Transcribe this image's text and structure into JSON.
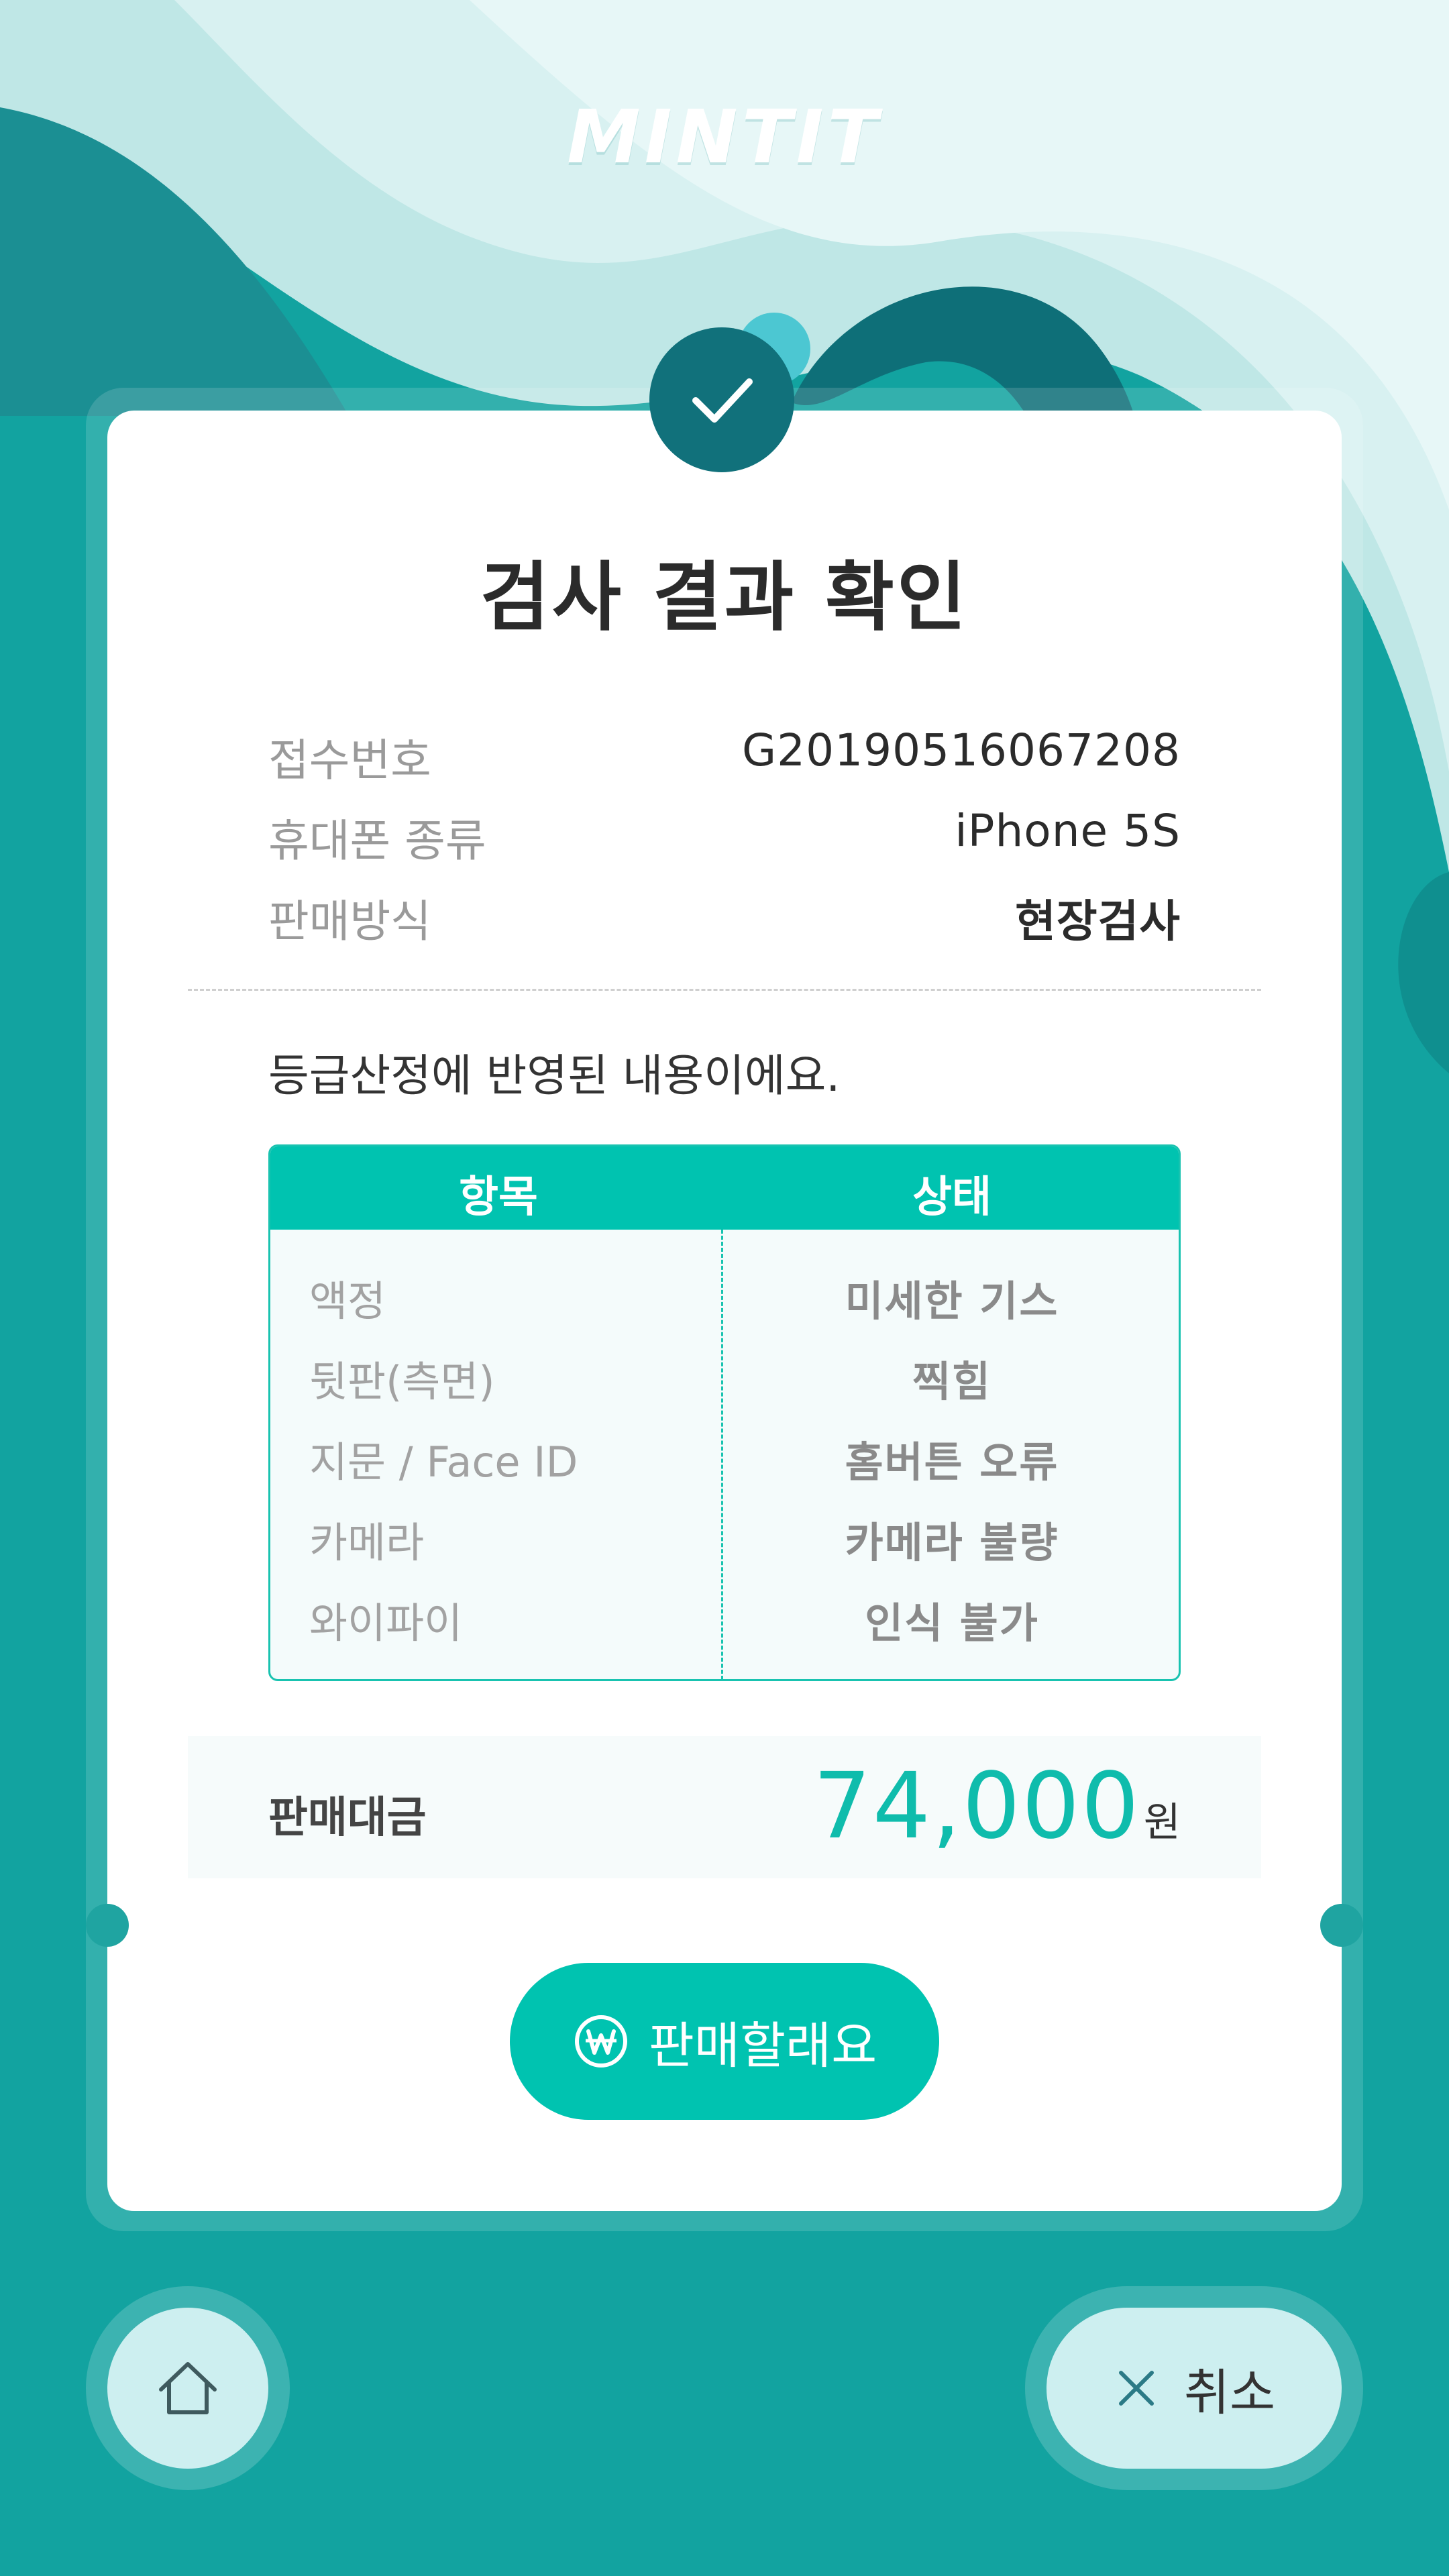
{
  "brand": {
    "logo_text": "MINTIT"
  },
  "page": {
    "title": "검사 결과 확인"
  },
  "info": [
    {
      "label": "접수번호",
      "value": "G20190516067208"
    },
    {
      "label": "휴대폰 종류",
      "value": "iPhone 5S"
    },
    {
      "label": "판매방식",
      "value": "현장검사"
    }
  ],
  "note": "등급산정에 반영된 내용이에요.",
  "table": {
    "headers": [
      "항목",
      "상태"
    ],
    "rows": [
      {
        "item": "액정",
        "status": "미세한 기스"
      },
      {
        "item": "뒷판(측면)",
        "status": "찍힘"
      },
      {
        "item": "지문 / Face ID",
        "status": "홈버튼 오류"
      },
      {
        "item": "카메라",
        "status": "카메라 불량"
      },
      {
        "item": "와이파이",
        "status": "인식 불가"
      }
    ]
  },
  "price": {
    "label": "판매대금",
    "amount": "74,000",
    "unit": "원"
  },
  "actions": {
    "sell_label": "판매할래요",
    "cancel_label": "취소"
  },
  "colors": {
    "accent": "#00c3b0",
    "dark_teal": "#11717b",
    "background": "#10a8a3"
  },
  "icons": [
    "check-icon",
    "won-icon",
    "home-icon",
    "close-icon"
  ]
}
